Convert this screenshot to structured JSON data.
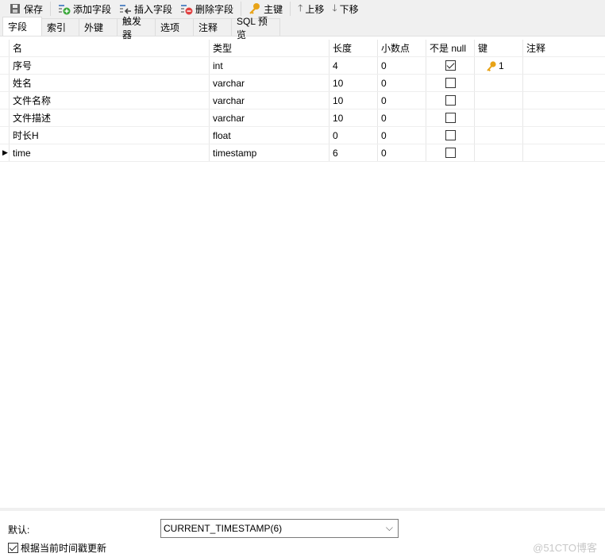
{
  "toolbar": {
    "save": "保存",
    "add_field": "添加字段",
    "insert_field": "插入字段",
    "delete_field": "删除字段",
    "primary_key": "主键",
    "move_up": "上移",
    "move_down": "下移"
  },
  "tabs": [
    "字段",
    "索引",
    "外键",
    "触发器",
    "选项",
    "注释",
    "SQL 预览"
  ],
  "columns": [
    "名",
    "类型",
    "长度",
    "小数点",
    "不是 null",
    "键",
    "注释"
  ],
  "rows": [
    {
      "name": "序号",
      "type": "int",
      "length": "4",
      "decimal": "0",
      "not_null": true,
      "key": "1"
    },
    {
      "name": "姓名",
      "type": "varchar",
      "length": "10",
      "decimal": "0",
      "not_null": false,
      "key": ""
    },
    {
      "name": "文件名称",
      "type": "varchar",
      "length": "10",
      "decimal": "0",
      "not_null": false,
      "key": ""
    },
    {
      "name": "文件描述",
      "type": "varchar",
      "length": "10",
      "decimal": "0",
      "not_null": false,
      "key": ""
    },
    {
      "name": "时长H",
      "type": "float",
      "length": "0",
      "decimal": "0",
      "not_null": false,
      "key": ""
    },
    {
      "name": "time",
      "type": "timestamp",
      "length": "6",
      "decimal": "0",
      "not_null": false,
      "key": ""
    }
  ],
  "bottom": {
    "default_label": "默认:",
    "default_value": "CURRENT_TIMESTAMP(6)",
    "update_label": "根据当前时间戳更新",
    "update_checked": true
  },
  "watermark": "@51CTO博客"
}
